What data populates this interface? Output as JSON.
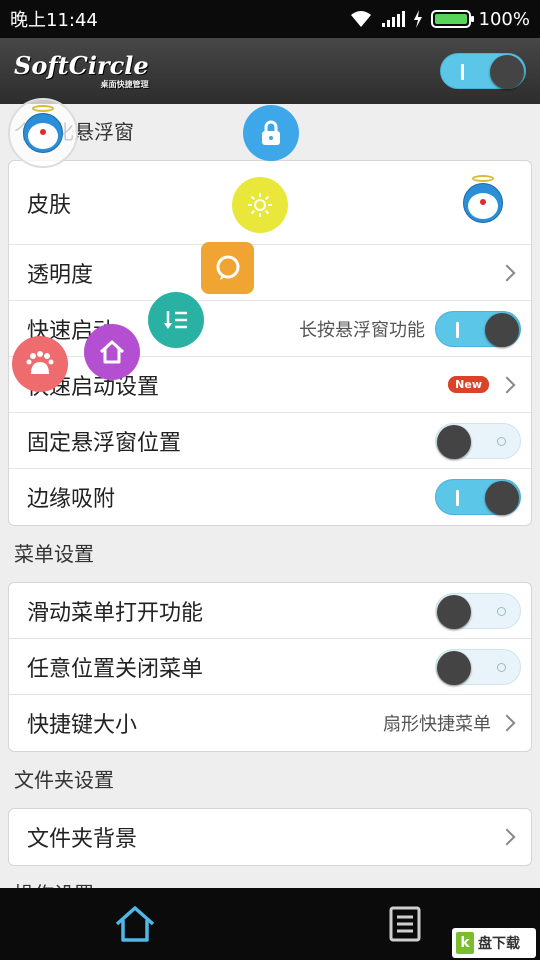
{
  "status_bar": {
    "time": "晚上11:44",
    "battery": "100%"
  },
  "app": {
    "logo": "SoftCircle",
    "logo_sub": "桌面快捷管理"
  },
  "sections": [
    {
      "title": "个性化悬浮窗",
      "rows": [
        {
          "label": "皮肤",
          "type": "skin"
        },
        {
          "label": "透明度",
          "type": "chevron"
        },
        {
          "label": "快速启动",
          "value": "长按悬浮窗功能",
          "type": "toggle",
          "on": true
        },
        {
          "label": "快速启动设置",
          "badge": "New",
          "type": "chevron"
        },
        {
          "label": "固定悬浮窗位置",
          "type": "toggle",
          "on": false
        },
        {
          "label": "边缘吸附",
          "type": "toggle",
          "on": true
        }
      ]
    },
    {
      "title": "菜单设置",
      "rows": [
        {
          "label": "滑动菜单打开功能",
          "type": "toggle",
          "on": false
        },
        {
          "label": "任意位置关闭菜单",
          "type": "toggle",
          "on": false
        },
        {
          "label": "快捷键大小",
          "value": "扇形快捷菜单",
          "type": "chevron"
        }
      ]
    },
    {
      "title": "文件夹设置",
      "rows": [
        {
          "label": "文件夹背景",
          "type": "chevron"
        }
      ]
    },
    {
      "title": "操作设置",
      "rows": []
    }
  ],
  "floating_menu": {
    "items": [
      {
        "name": "lock-icon",
        "color": "#3ea7ea"
      },
      {
        "name": "brightness-icon",
        "color": "#e9e83a"
      },
      {
        "name": "chat-icon",
        "color": "#f0a432"
      },
      {
        "name": "list-icon",
        "color": "#29b2a4"
      },
      {
        "name": "home-icon",
        "color": "#b44fd2"
      },
      {
        "name": "baidu-icon",
        "color": "#ee6b6e",
        "text": "du"
      }
    ]
  },
  "watermark": {
    "text": "盘下载"
  },
  "colors": {
    "accent": "#5cc6e8",
    "header": "#2d2d2d"
  }
}
